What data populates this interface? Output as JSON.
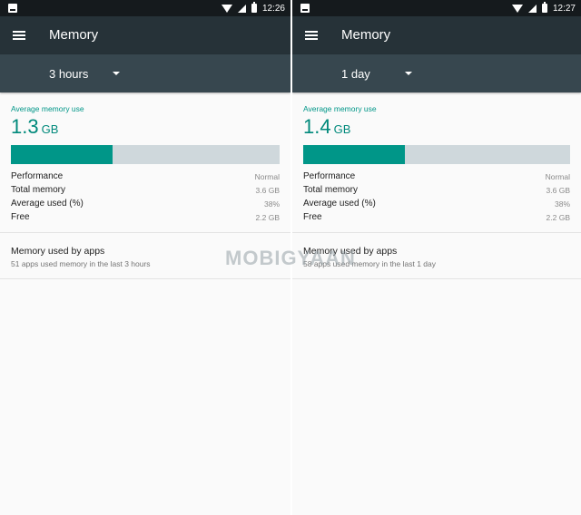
{
  "watermark": "MOBIGYAAN",
  "colors": {
    "accent": "#009688",
    "toolbar": "#263238",
    "spinner_bar": "#37474f",
    "statusbar": "#151a1d",
    "bar_track": "#cfd8dc"
  },
  "panels": [
    {
      "status_time": "12:26",
      "title": "Memory",
      "period": "3 hours",
      "avg_label": "Average memory use",
      "avg_value": "1.3",
      "avg_unit": "GB",
      "usage_fraction": 0.38,
      "stats": [
        {
          "key": "Performance",
          "value": "Normal"
        },
        {
          "key": "Total memory",
          "value": "3.6 GB"
        },
        {
          "key": "Average used (%)",
          "value": "38%"
        },
        {
          "key": "Free",
          "value": "2.2 GB"
        }
      ],
      "apps_title": "Memory used by apps",
      "apps_subtitle": "51 apps used memory in the last 3 hours"
    },
    {
      "status_time": "12:27",
      "title": "Memory",
      "period": "1 day",
      "avg_label": "Average memory use",
      "avg_value": "1.4",
      "avg_unit": "GB",
      "usage_fraction": 0.38,
      "stats": [
        {
          "key": "Performance",
          "value": "Normal"
        },
        {
          "key": "Total memory",
          "value": "3.6 GB"
        },
        {
          "key": "Average used (%)",
          "value": "38%"
        },
        {
          "key": "Free",
          "value": "2.2 GB"
        }
      ],
      "apps_title": "Memory used by apps",
      "apps_subtitle": "58 apps used memory in the last 1 day"
    }
  ]
}
